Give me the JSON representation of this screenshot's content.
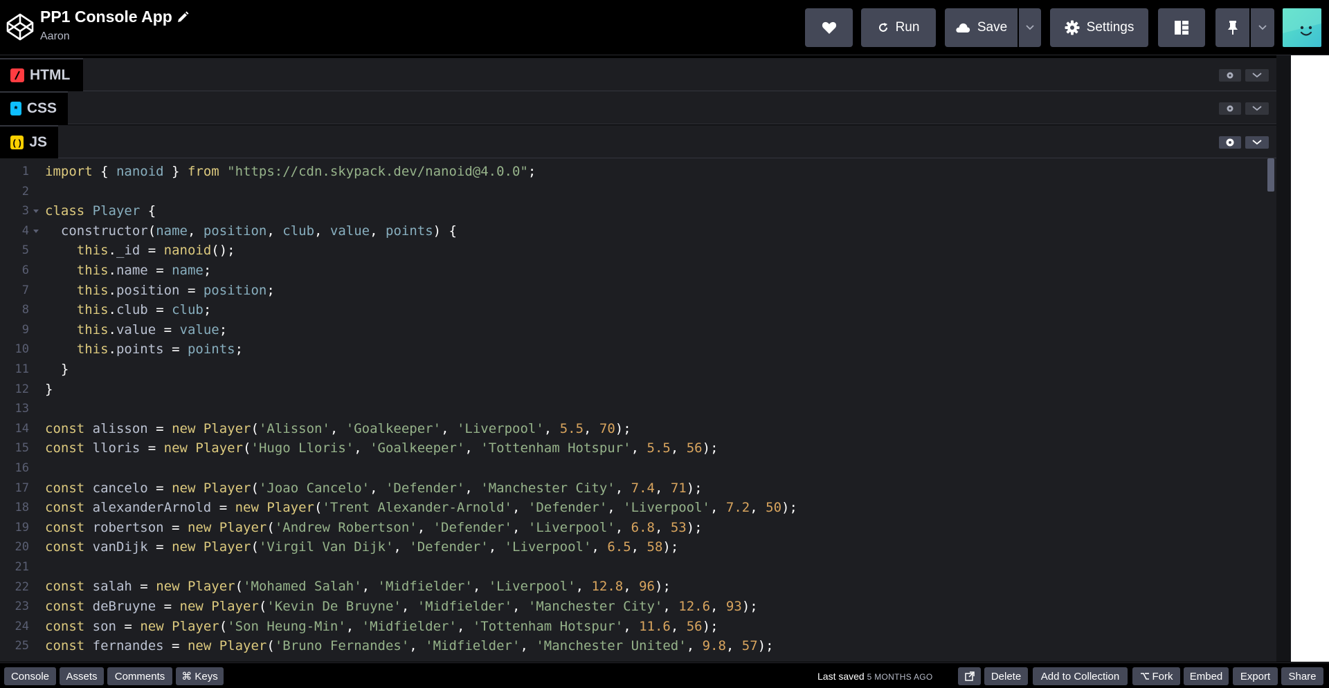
{
  "header": {
    "title": "PP1 Console App",
    "author": "Aaron",
    "buttons": {
      "run": "Run",
      "save": "Save",
      "settings": "Settings"
    }
  },
  "panels": {
    "html": "HTML",
    "css": "CSS",
    "js": "JS"
  },
  "code_lines": [
    [
      [
        "kw",
        "import"
      ],
      [
        "pn",
        " { "
      ],
      [
        "v",
        "nanoid"
      ],
      [
        "pn",
        " } "
      ],
      [
        "kw",
        "from"
      ],
      [
        "pn",
        " "
      ],
      [
        "str",
        "\"https://cdn.skypack.dev/nanoid@4.0.0\""
      ],
      [
        "pn",
        ";"
      ]
    ],
    [],
    [
      [
        "kw",
        "class"
      ],
      [
        "pn",
        " "
      ],
      [
        "v",
        "Player"
      ],
      [
        "pn",
        " {"
      ]
    ],
    [
      [
        "pn",
        "  "
      ],
      [
        "id",
        "constructor"
      ],
      [
        "pn",
        "("
      ],
      [
        "v",
        "name"
      ],
      [
        "pn",
        ", "
      ],
      [
        "v",
        "position"
      ],
      [
        "pn",
        ", "
      ],
      [
        "v",
        "club"
      ],
      [
        "pn",
        ", "
      ],
      [
        "v",
        "value"
      ],
      [
        "pn",
        ", "
      ],
      [
        "v",
        "points"
      ],
      [
        "pn",
        ") {"
      ]
    ],
    [
      [
        "pn",
        "    "
      ],
      [
        "kw",
        "this"
      ],
      [
        "pn",
        "."
      ],
      [
        "prop",
        "_id"
      ],
      [
        "pn",
        " = "
      ],
      [
        "kw",
        "nanoid"
      ],
      [
        "pn",
        "();"
      ]
    ],
    [
      [
        "pn",
        "    "
      ],
      [
        "kw",
        "this"
      ],
      [
        "pn",
        "."
      ],
      [
        "prop",
        "name"
      ],
      [
        "pn",
        " = "
      ],
      [
        "v",
        "name"
      ],
      [
        "pn",
        ";"
      ]
    ],
    [
      [
        "pn",
        "    "
      ],
      [
        "kw",
        "this"
      ],
      [
        "pn",
        "."
      ],
      [
        "prop",
        "position"
      ],
      [
        "pn",
        " = "
      ],
      [
        "v",
        "position"
      ],
      [
        "pn",
        ";"
      ]
    ],
    [
      [
        "pn",
        "    "
      ],
      [
        "kw",
        "this"
      ],
      [
        "pn",
        "."
      ],
      [
        "prop",
        "club"
      ],
      [
        "pn",
        " = "
      ],
      [
        "v",
        "club"
      ],
      [
        "pn",
        ";"
      ]
    ],
    [
      [
        "pn",
        "    "
      ],
      [
        "kw",
        "this"
      ],
      [
        "pn",
        "."
      ],
      [
        "prop",
        "value"
      ],
      [
        "pn",
        " = "
      ],
      [
        "v",
        "value"
      ],
      [
        "pn",
        ";"
      ]
    ],
    [
      [
        "pn",
        "    "
      ],
      [
        "kw",
        "this"
      ],
      [
        "pn",
        "."
      ],
      [
        "prop",
        "points"
      ],
      [
        "pn",
        " = "
      ],
      [
        "v",
        "points"
      ],
      [
        "pn",
        ";"
      ]
    ],
    [
      [
        "pn",
        "  }"
      ]
    ],
    [
      [
        "pn",
        "}"
      ]
    ],
    [],
    [
      [
        "kw",
        "const"
      ],
      [
        "pn",
        " "
      ],
      [
        "id",
        "alisson"
      ],
      [
        "pn",
        " = "
      ],
      [
        "kw",
        "new"
      ],
      [
        "pn",
        " "
      ],
      [
        "kw",
        "Player"
      ],
      [
        "pn",
        "("
      ],
      [
        "str",
        "'Alisson'"
      ],
      [
        "pn",
        ", "
      ],
      [
        "str",
        "'Goalkeeper'"
      ],
      [
        "pn",
        ", "
      ],
      [
        "str",
        "'Liverpool'"
      ],
      [
        "pn",
        ", "
      ],
      [
        "num",
        "5.5"
      ],
      [
        "pn",
        ", "
      ],
      [
        "num",
        "70"
      ],
      [
        "pn",
        ");"
      ]
    ],
    [
      [
        "kw",
        "const"
      ],
      [
        "pn",
        " "
      ],
      [
        "id",
        "lloris"
      ],
      [
        "pn",
        " = "
      ],
      [
        "kw",
        "new"
      ],
      [
        "pn",
        " "
      ],
      [
        "kw",
        "Player"
      ],
      [
        "pn",
        "("
      ],
      [
        "str",
        "'Hugo Lloris'"
      ],
      [
        "pn",
        ", "
      ],
      [
        "str",
        "'Goalkeeper'"
      ],
      [
        "pn",
        ", "
      ],
      [
        "str",
        "'Tottenham Hotspur'"
      ],
      [
        "pn",
        ", "
      ],
      [
        "num",
        "5.5"
      ],
      [
        "pn",
        ", "
      ],
      [
        "num",
        "56"
      ],
      [
        "pn",
        ");"
      ]
    ],
    [],
    [
      [
        "kw",
        "const"
      ],
      [
        "pn",
        " "
      ],
      [
        "id",
        "cancelo"
      ],
      [
        "pn",
        " = "
      ],
      [
        "kw",
        "new"
      ],
      [
        "pn",
        " "
      ],
      [
        "kw",
        "Player"
      ],
      [
        "pn",
        "("
      ],
      [
        "str",
        "'Joao Cancelo'"
      ],
      [
        "pn",
        ", "
      ],
      [
        "str",
        "'Defender'"
      ],
      [
        "pn",
        ", "
      ],
      [
        "str",
        "'Manchester City'"
      ],
      [
        "pn",
        ", "
      ],
      [
        "num",
        "7.4"
      ],
      [
        "pn",
        ", "
      ],
      [
        "num",
        "71"
      ],
      [
        "pn",
        ");"
      ]
    ],
    [
      [
        "kw",
        "const"
      ],
      [
        "pn",
        " "
      ],
      [
        "id",
        "alexanderArnold"
      ],
      [
        "pn",
        " = "
      ],
      [
        "kw",
        "new"
      ],
      [
        "pn",
        " "
      ],
      [
        "kw",
        "Player"
      ],
      [
        "pn",
        "("
      ],
      [
        "str",
        "'Trent Alexander-Arnold'"
      ],
      [
        "pn",
        ", "
      ],
      [
        "str",
        "'Defender'"
      ],
      [
        "pn",
        ", "
      ],
      [
        "str",
        "'Liverpool'"
      ],
      [
        "pn",
        ", "
      ],
      [
        "num",
        "7.2"
      ],
      [
        "pn",
        ", "
      ],
      [
        "num",
        "50"
      ],
      [
        "pn",
        ");"
      ]
    ],
    [
      [
        "kw",
        "const"
      ],
      [
        "pn",
        " "
      ],
      [
        "id",
        "robertson"
      ],
      [
        "pn",
        " = "
      ],
      [
        "kw",
        "new"
      ],
      [
        "pn",
        " "
      ],
      [
        "kw",
        "Player"
      ],
      [
        "pn",
        "("
      ],
      [
        "str",
        "'Andrew Robertson'"
      ],
      [
        "pn",
        ", "
      ],
      [
        "str",
        "'Defender'"
      ],
      [
        "pn",
        ", "
      ],
      [
        "str",
        "'Liverpool'"
      ],
      [
        "pn",
        ", "
      ],
      [
        "num",
        "6.8"
      ],
      [
        "pn",
        ", "
      ],
      [
        "num",
        "53"
      ],
      [
        "pn",
        ");"
      ]
    ],
    [
      [
        "kw",
        "const"
      ],
      [
        "pn",
        " "
      ],
      [
        "id",
        "vanDijk"
      ],
      [
        "pn",
        " = "
      ],
      [
        "kw",
        "new"
      ],
      [
        "pn",
        " "
      ],
      [
        "kw",
        "Player"
      ],
      [
        "pn",
        "("
      ],
      [
        "str",
        "'Virgil Van Dijk'"
      ],
      [
        "pn",
        ", "
      ],
      [
        "str",
        "'Defender'"
      ],
      [
        "pn",
        ", "
      ],
      [
        "str",
        "'Liverpool'"
      ],
      [
        "pn",
        ", "
      ],
      [
        "num",
        "6.5"
      ],
      [
        "pn",
        ", "
      ],
      [
        "num",
        "58"
      ],
      [
        "pn",
        ");"
      ]
    ],
    [],
    [
      [
        "kw",
        "const"
      ],
      [
        "pn",
        " "
      ],
      [
        "id",
        "salah"
      ],
      [
        "pn",
        " = "
      ],
      [
        "kw",
        "new"
      ],
      [
        "pn",
        " "
      ],
      [
        "kw",
        "Player"
      ],
      [
        "pn",
        "("
      ],
      [
        "str",
        "'Mohamed Salah'"
      ],
      [
        "pn",
        ", "
      ],
      [
        "str",
        "'Midfielder'"
      ],
      [
        "pn",
        ", "
      ],
      [
        "str",
        "'Liverpool'"
      ],
      [
        "pn",
        ", "
      ],
      [
        "num",
        "12.8"
      ],
      [
        "pn",
        ", "
      ],
      [
        "num",
        "96"
      ],
      [
        "pn",
        ");"
      ]
    ],
    [
      [
        "kw",
        "const"
      ],
      [
        "pn",
        " "
      ],
      [
        "id",
        "deBruyne"
      ],
      [
        "pn",
        " = "
      ],
      [
        "kw",
        "new"
      ],
      [
        "pn",
        " "
      ],
      [
        "kw",
        "Player"
      ],
      [
        "pn",
        "("
      ],
      [
        "str",
        "'Kevin De Bruyne'"
      ],
      [
        "pn",
        ", "
      ],
      [
        "str",
        "'Midfielder'"
      ],
      [
        "pn",
        ", "
      ],
      [
        "str",
        "'Manchester City'"
      ],
      [
        "pn",
        ", "
      ],
      [
        "num",
        "12.6"
      ],
      [
        "pn",
        ", "
      ],
      [
        "num",
        "93"
      ],
      [
        "pn",
        ");"
      ]
    ],
    [
      [
        "kw",
        "const"
      ],
      [
        "pn",
        " "
      ],
      [
        "id",
        "son"
      ],
      [
        "pn",
        " = "
      ],
      [
        "kw",
        "new"
      ],
      [
        "pn",
        " "
      ],
      [
        "kw",
        "Player"
      ],
      [
        "pn",
        "("
      ],
      [
        "str",
        "'Son Heung-Min'"
      ],
      [
        "pn",
        ", "
      ],
      [
        "str",
        "'Midfielder'"
      ],
      [
        "pn",
        ", "
      ],
      [
        "str",
        "'Tottenham Hotspur'"
      ],
      [
        "pn",
        ", "
      ],
      [
        "num",
        "11.6"
      ],
      [
        "pn",
        ", "
      ],
      [
        "num",
        "56"
      ],
      [
        "pn",
        ");"
      ]
    ],
    [
      [
        "kw",
        "const"
      ],
      [
        "pn",
        " "
      ],
      [
        "id",
        "fernandes"
      ],
      [
        "pn",
        " = "
      ],
      [
        "kw",
        "new"
      ],
      [
        "pn",
        " "
      ],
      [
        "kw",
        "Player"
      ],
      [
        "pn",
        "("
      ],
      [
        "str",
        "'Bruno Fernandes'"
      ],
      [
        "pn",
        ", "
      ],
      [
        "str",
        "'Midfielder'"
      ],
      [
        "pn",
        ", "
      ],
      [
        "str",
        "'Manchester United'"
      ],
      [
        "pn",
        ", "
      ],
      [
        "num",
        "9.8"
      ],
      [
        "pn",
        ", "
      ],
      [
        "num",
        "57"
      ],
      [
        "pn",
        ");"
      ]
    ]
  ],
  "line_numbers": [
    "1",
    "2",
    "3",
    "4",
    "5",
    "6",
    "7",
    "8",
    "9",
    "10",
    "11",
    "12",
    "13",
    "14",
    "15",
    "16",
    "17",
    "18",
    "19",
    "20",
    "21",
    "22",
    "23",
    "24",
    "25"
  ],
  "footer": {
    "left_buttons": [
      "Console",
      "Assets",
      "Comments",
      "⌘ Keys"
    ],
    "last_saved_label": "Last saved",
    "last_saved_ago": "5 MONTHS AGO",
    "right_buttons": {
      "delete": "Delete",
      "add_to_collection": "Add to Collection",
      "fork": "Fork",
      "embed": "Embed",
      "export": "Export",
      "share": "Share"
    }
  },
  "colors": {
    "keyword": "#ddca7e",
    "string": "#96b38a",
    "number": "#d9a55e",
    "variable": "#88afbf",
    "button_bg": "#444857",
    "editor_bg": "#1d1e22"
  }
}
